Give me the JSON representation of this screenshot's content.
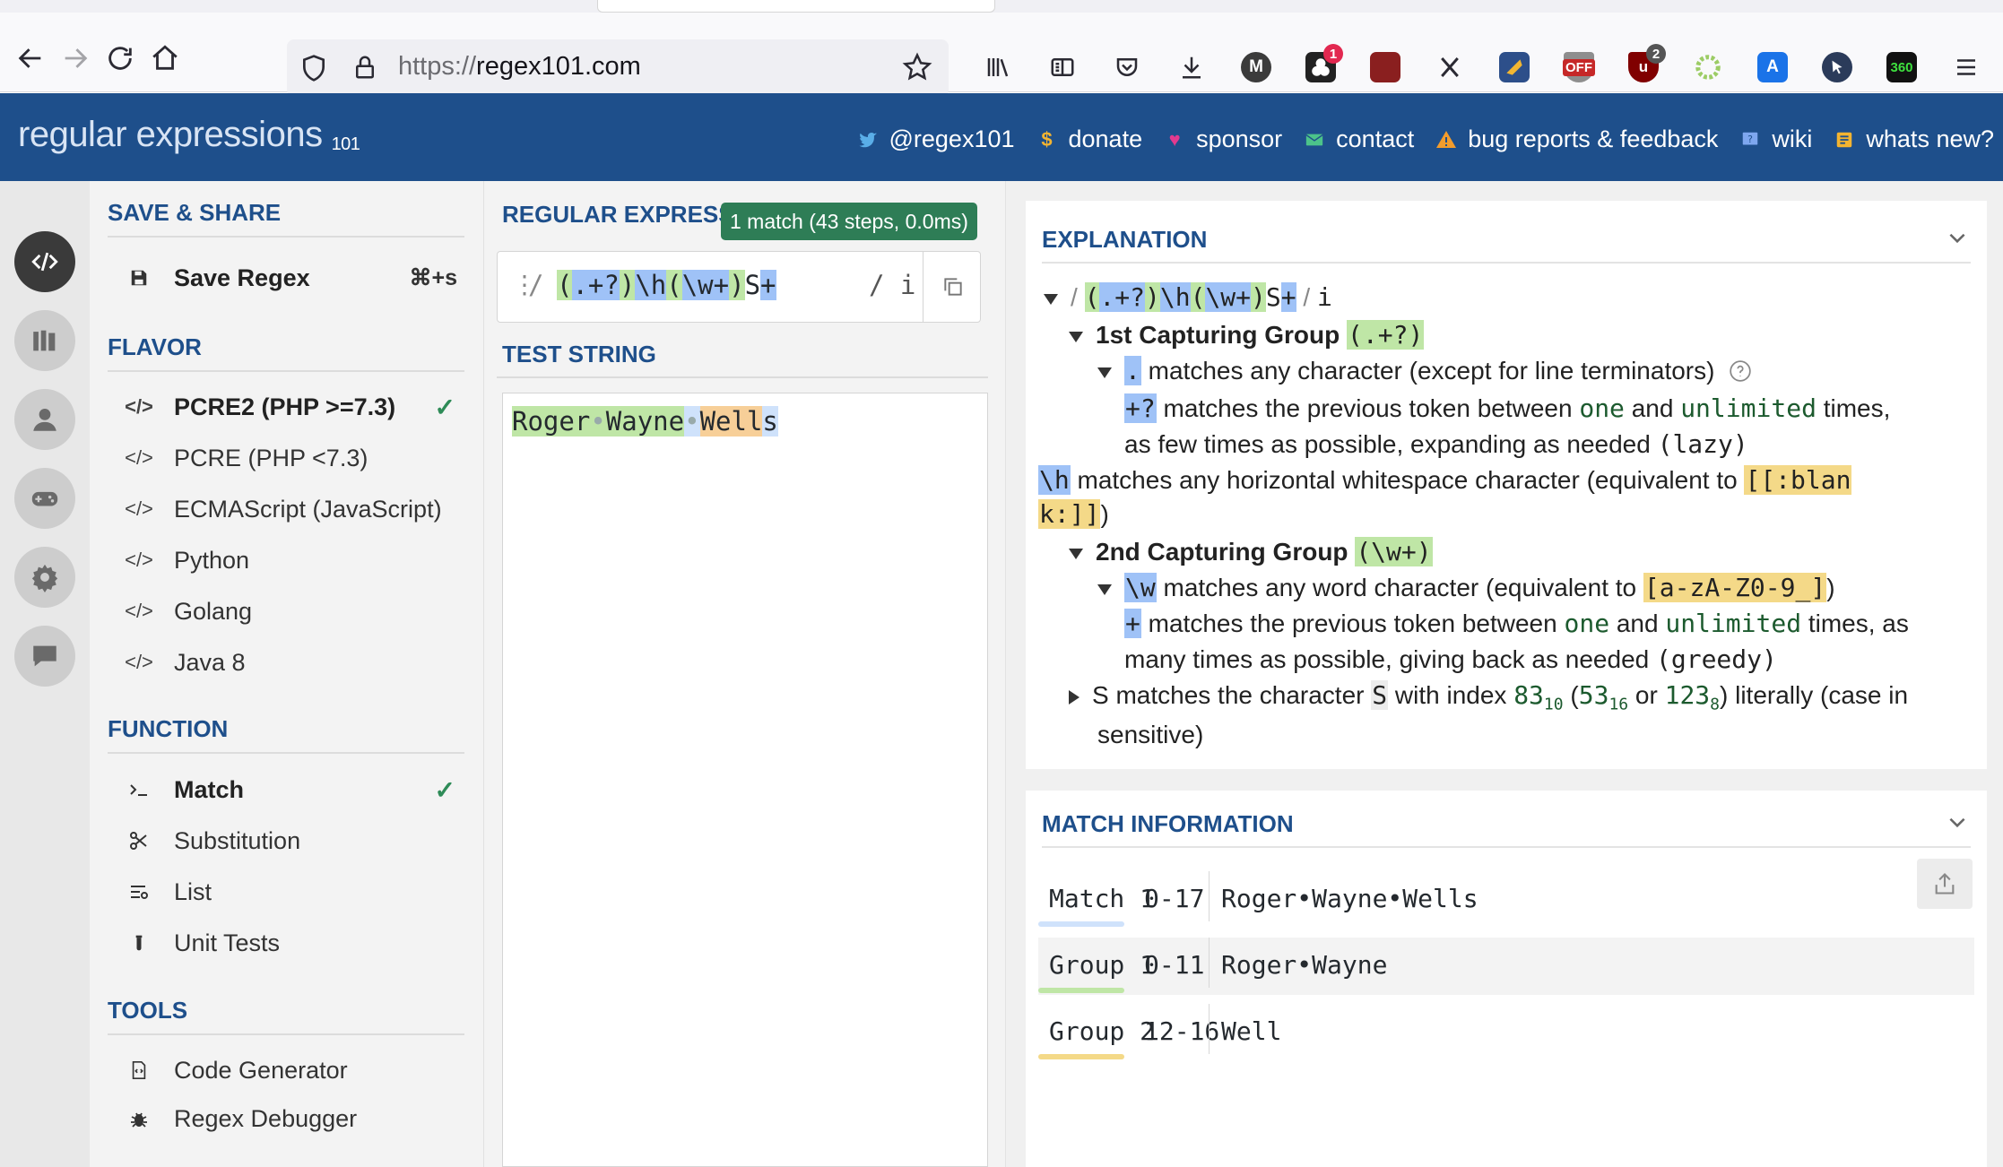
{
  "browser": {
    "url_scheme": "https://",
    "url_host": "regex101.com",
    "extensions": [
      {
        "icon": "library-icon"
      },
      {
        "icon": "reader-view-icon"
      },
      {
        "icon": "pocket-icon"
      },
      {
        "icon": "download-icon"
      },
      {
        "icon": "m-extension-icon",
        "label": "M"
      },
      {
        "icon": "extension-icon",
        "badge": "1"
      },
      {
        "icon": "extension-icon"
      },
      {
        "icon": "extension-icon"
      },
      {
        "icon": "extension-icon"
      },
      {
        "icon": "extension-icon",
        "label": "OFF"
      },
      {
        "icon": "ublock-icon",
        "badge": "2"
      },
      {
        "icon": "extension-icon"
      },
      {
        "icon": "translate-icon"
      },
      {
        "icon": "cursor-extension-icon"
      },
      {
        "icon": "extension-icon",
        "label": "360"
      },
      {
        "icon": "hamburger-menu-icon"
      }
    ]
  },
  "header": {
    "logo_main": "regular expressions",
    "logo_sub": "101",
    "links": [
      {
        "icon": "twitter-icon",
        "label": "@regex101"
      },
      {
        "icon": "dollar-icon",
        "label": "donate"
      },
      {
        "icon": "heart-icon",
        "label": "sponsor"
      },
      {
        "icon": "mail-icon",
        "label": "contact"
      },
      {
        "icon": "warning-icon",
        "label": "bug reports & feedback"
      },
      {
        "icon": "wiki-icon",
        "label": "wiki"
      },
      {
        "icon": "news-icon",
        "label": "whats new?"
      }
    ]
  },
  "menu": {
    "save_share_title": "SAVE & SHARE",
    "save_regex_label": "Save Regex",
    "save_regex_shortcut": "⌘+s",
    "flavor_title": "FLAVOR",
    "flavors": [
      "PCRE2 (PHP >=7.3)",
      "PCRE (PHP <7.3)",
      "ECMAScript (JavaScript)",
      "Python",
      "Golang",
      "Java 8"
    ],
    "function_title": "FUNCTION",
    "functions": [
      "Match",
      "Substitution",
      "List",
      "Unit Tests"
    ],
    "tools_title": "TOOLS",
    "tools": [
      "Code Generator",
      "Regex Debugger"
    ]
  },
  "regex": {
    "title": "REGULAR EXPRESSI",
    "match_badge": "1 match (43 steps, 0.0ms)",
    "delimiter": "/",
    "flags": "/ i",
    "pattern_tokens": [
      "(",
      ".+?",
      ")",
      "\\h",
      "(",
      "\\w+",
      ")",
      "S",
      "+"
    ]
  },
  "test_string": {
    "title": "TEST STRING",
    "group1_part1": "Roger",
    "dot1": "•",
    "group1_part2": "Wayne",
    "dot2": "•",
    "group2": "Well",
    "tail": "s"
  },
  "explanation": {
    "title": "EXPLANATION",
    "root_delim_open": "/",
    "root_pattern": [
      "(",
      ".+?",
      ")",
      "\\h",
      "(",
      "\\w+",
      ")",
      "S",
      "+"
    ],
    "root_delim_close": "/",
    "root_flag": "i",
    "group1_title": "1st Capturing Group",
    "group1_pattern": "(.+?)",
    "dot_token": ".",
    "dot_text": "matches any character (except for line terminators)",
    "lazy_token": "+?",
    "lazy_text_a": "matches the previous token between",
    "lazy_one": "one",
    "lazy_and": "and",
    "lazy_unlimited": "unlimited",
    "lazy_text_b": "times,",
    "lazy_text_c": "as few times as possible, expanding as needed",
    "lazy_word": "(lazy)",
    "h_token": "\\h",
    "h_text": "matches any horizontal whitespace character (equivalent to",
    "h_class_a": "[[:blan",
    "h_class_b": "k:]]",
    "h_close": ")",
    "group2_title": "2nd Capturing Group",
    "group2_pattern": "(\\w+)",
    "w_token": "\\w",
    "w_text": "matches any word character (equivalent to",
    "w_class": "[a-zA-Z0-9_]",
    "w_close": ")",
    "greedy_token": "+",
    "greedy_text_a": "matches the previous token between",
    "greedy_one": "one",
    "greedy_and": "and",
    "greedy_unlimited": "unlimited",
    "greedy_text_b": "times, as",
    "greedy_text_c": "many times as possible, giving back as needed",
    "greedy_word": "(greedy)",
    "s_text_a": "S matches the character",
    "s_char": "S",
    "s_text_b": "with index",
    "s_dec": "83",
    "s_dec_base": "10",
    "s_hex": "53",
    "s_hex_base": "16",
    "s_or": "or",
    "s_oct": "123",
    "s_oct_base": "8",
    "s_text_c": ") literally (case in",
    "s_text_d": "sensitive)"
  },
  "match_info": {
    "title": "MATCH INFORMATION",
    "rows": [
      {
        "label": "Match 1",
        "range": "0-17",
        "value": "Roger•Wayne•Wells",
        "color": "#9fc2f7"
      },
      {
        "label": "Group 1",
        "range": "0-11",
        "value": "Roger•Wayne",
        "color": "#bfe6a6"
      },
      {
        "label": "Group 2",
        "range": "12-16",
        "value": "Well",
        "color": "#f4d988"
      }
    ]
  },
  "colors": {
    "header_bg": "#1e4f8b",
    "accent": "#1e4f8b",
    "match_badge_bg": "#2e7d56",
    "token_blue": "#9fc2f7",
    "token_green": "#bfe6a6",
    "token_yellow": "#f4d988"
  }
}
